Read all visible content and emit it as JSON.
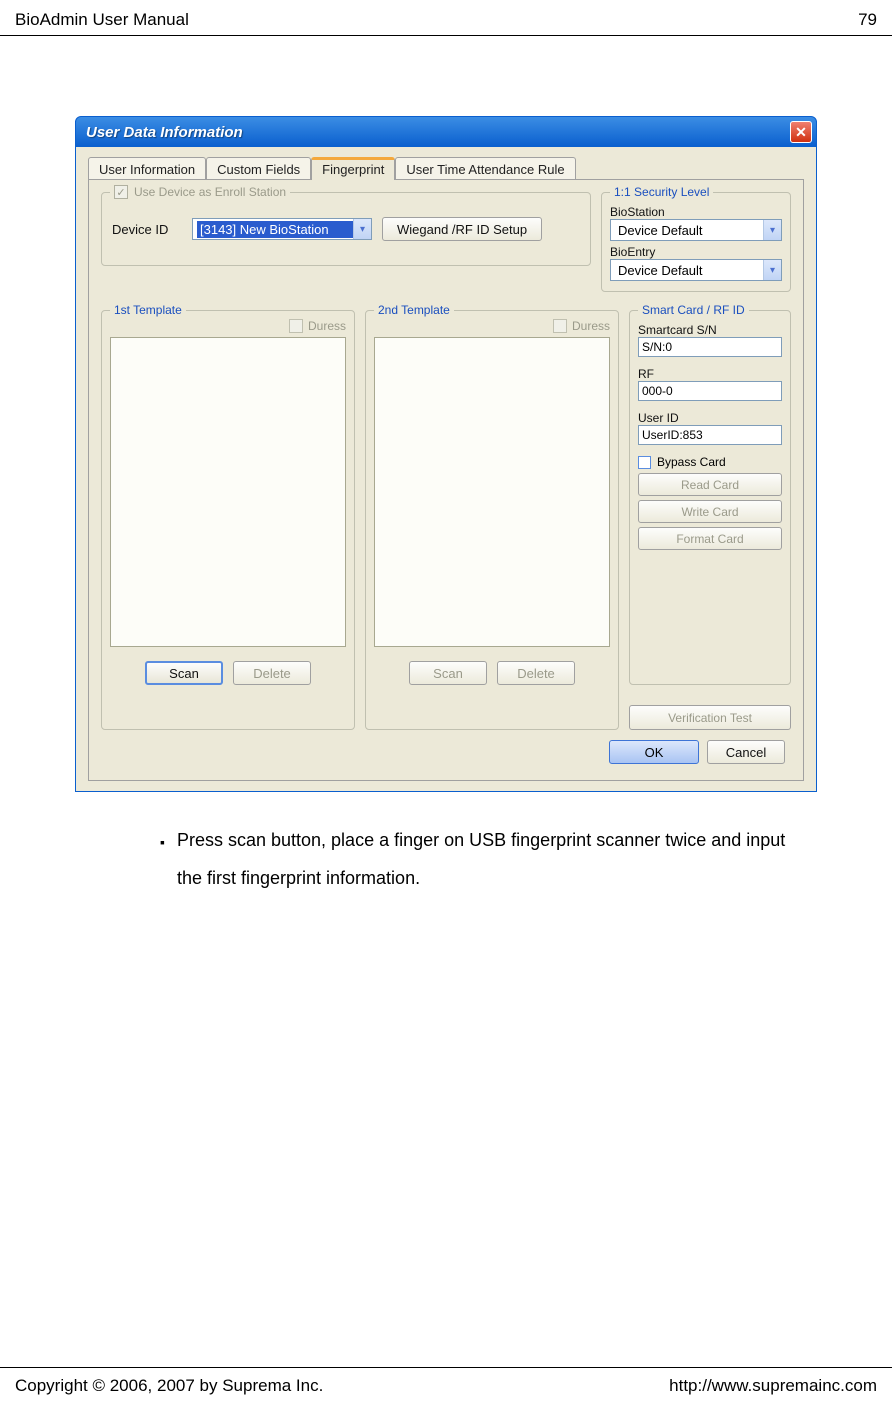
{
  "page": {
    "header_left": "BioAdmin User Manual",
    "header_right": "79",
    "footer_left": "Copyright © 2006, 2007 by Suprema Inc.",
    "footer_right": "http://www.supremainc.com"
  },
  "dialog": {
    "title": "User Data Information",
    "tabs": {
      "t1": "User Information",
      "t2": "Custom Fields",
      "t3": "Fingerprint",
      "t4": "User Time Attendance Rule"
    },
    "enroll": {
      "legend": "Use Device as Enroll Station",
      "device_id_label": "Device ID",
      "device_value": "[3143] New BioStation",
      "wiegand_btn": "Wiegand /RF ID Setup"
    },
    "security": {
      "legend": "1:1 Security Level",
      "biostation_label": "BioStation",
      "biostation_value": "Device Default",
      "bioentry_label": "BioEntry",
      "bioentry_value": "Device Default"
    },
    "template1": {
      "legend": "1st Template",
      "duress": "Duress",
      "scan": "Scan",
      "delete": "Delete"
    },
    "template2": {
      "legend": "2nd Template",
      "duress": "Duress",
      "scan": "Scan",
      "delete": "Delete"
    },
    "smartcard": {
      "legend": "Smart Card / RF ID",
      "sn_label": "Smartcard S/N",
      "sn_value": "S/N:0",
      "rf_label": "RF",
      "rf_value": "000-0",
      "userid_label": "User ID",
      "userid_value": "UserID:853",
      "bypass": "Bypass Card",
      "read": "Read Card",
      "write": "Write Card",
      "format": "Format Card",
      "verify": "Verification Test"
    },
    "footer": {
      "ok": "OK",
      "cancel": "Cancel"
    }
  },
  "instruction": "Press scan button, place a finger on USB fingerprint scanner twice and input the first fingerprint information."
}
